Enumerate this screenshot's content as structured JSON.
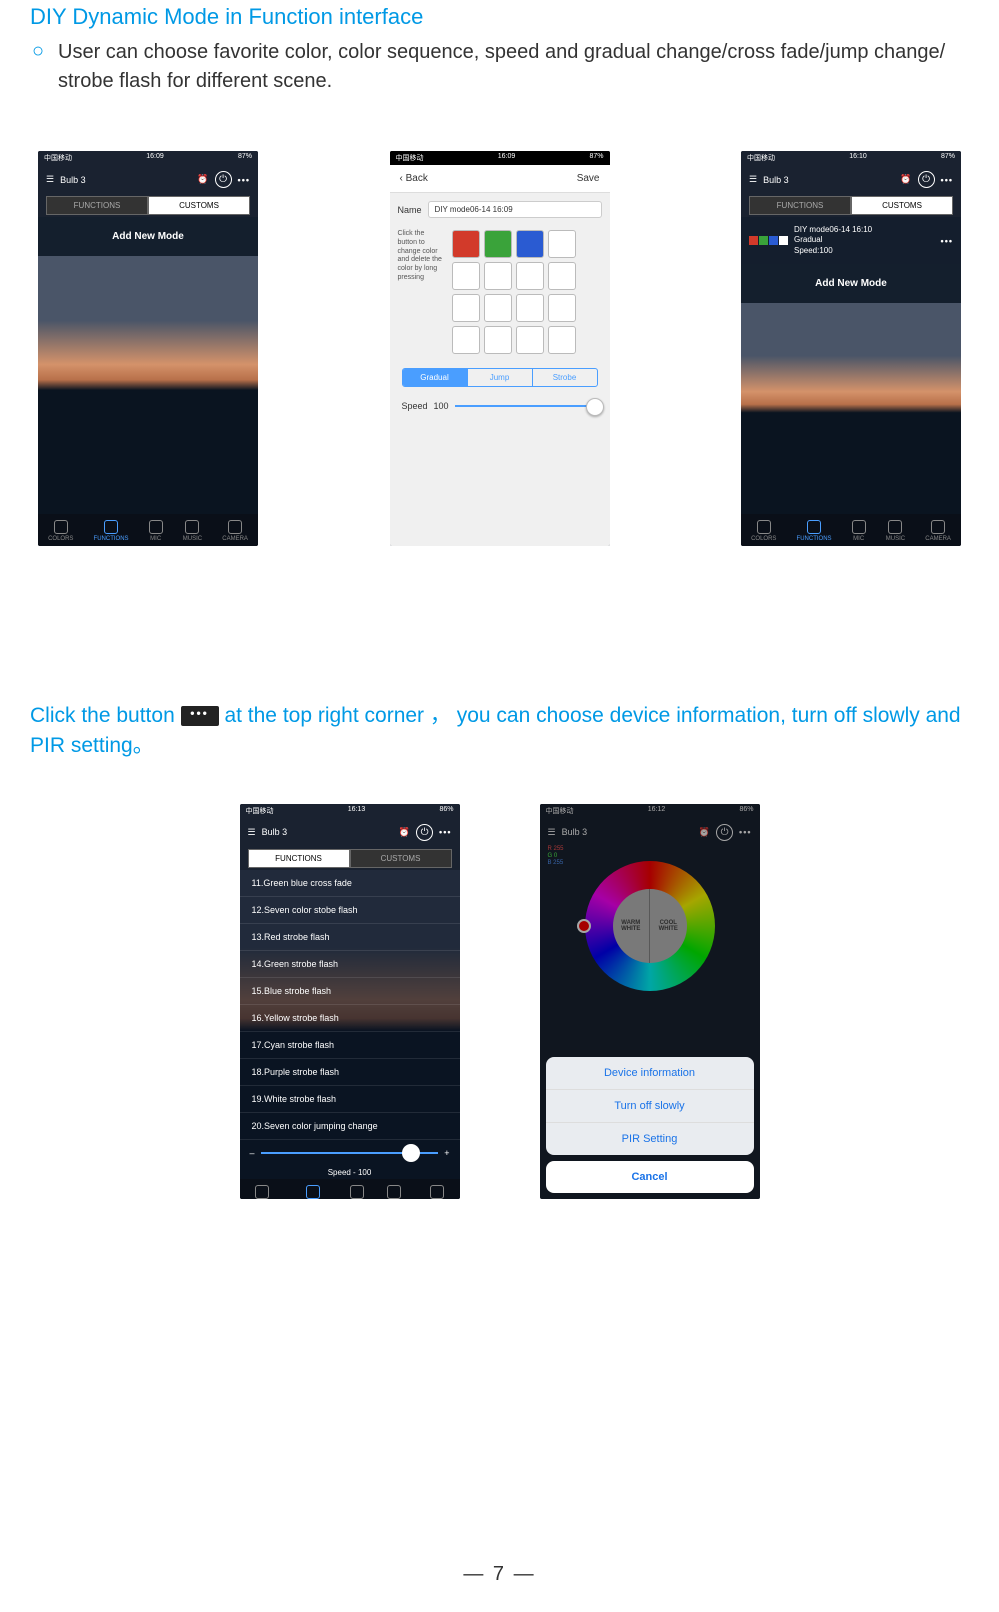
{
  "heading": "DIY Dynamic Mode in Function interface",
  "bullet_glyph": "○",
  "bullet_text": "User can choose favorite color, color sequence, speed and gradual change/cross fade/jump change/ strobe flash for different scene.",
  "status": {
    "carrier": "中国移动",
    "t1": "16:09",
    "t2": "16:09",
    "t3": "16:10",
    "t4": "16:13",
    "t5": "16:12",
    "batt1": "87%",
    "batt4": "86%"
  },
  "bulb_title": "Bulb 3",
  "tabs": {
    "functions": "FUNCTIONS",
    "customs": "CUSTOMS"
  },
  "add_new_mode": "Add New Mode",
  "nav": {
    "colors": "COLORS",
    "functions": "FUNCTIONS",
    "mic": "MIC",
    "music": "MUSIC",
    "camera": "CAMERA"
  },
  "editor": {
    "back": "Back",
    "save": "Save",
    "name_label": "Name",
    "name_value": "DIY mode06-14 16:09",
    "hint": "Click the button to change color and delete the color by long pressing",
    "swatches": [
      "#d23a2a",
      "#3aa33a",
      "#2a5bd2",
      "#ffffff"
    ],
    "seg": {
      "gradual": "Gradual",
      "jump": "Jump",
      "strobe": "Strobe"
    },
    "speed_label": "Speed",
    "speed_value": "100"
  },
  "diy_card": {
    "swatches": [
      "#d23a2a",
      "#3aa33a",
      "#2a5bd2",
      "#ffffff"
    ],
    "title": "DIY mode06-14 16:10",
    "mode": "Gradual",
    "speed": "Speed:100"
  },
  "sec2_pre": "Click the button",
  "sec2_post": " at the top right corner ，  you can choose device information, turn off slowly and PIR setting。",
  "flist": [
    "11.Green blue cross fade",
    "12.Seven color stobe flash",
    "13.Red strobe flash",
    "14.Green strobe flash",
    "15.Blue strobe flash",
    "16.Yellow strobe flash",
    "17.Cyan strobe flash",
    "18.Purple strobe flash",
    "19.White strobe flash",
    "20.Seven color jumping change"
  ],
  "speed_label": "Speed - 100",
  "wheel": {
    "warm1": "WARM",
    "warm2": "WHITE",
    "cool1": "COOL",
    "cool2": "WHITE"
  },
  "rgb": {
    "r": "R 255",
    "g": "G 0",
    "b": "B 255"
  },
  "sheet": {
    "device_info": "Device information",
    "turn_off": "Turn off slowly",
    "pir": "PIR Setting",
    "cancel": "Cancel"
  },
  "page_num": "— 7 —",
  "ellipsis": "•••",
  "back_chevron": "‹"
}
